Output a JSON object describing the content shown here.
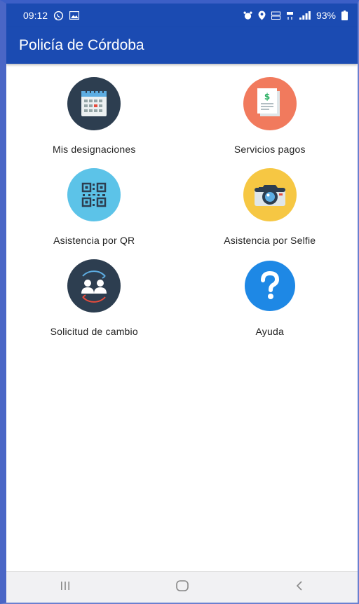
{
  "status": {
    "time": "09:12",
    "battery": "93%"
  },
  "appbar": {
    "title": "Policía de Córdoba"
  },
  "colors": {
    "primary": "#1b4bb2",
    "calendar_bg": "#2d3e50",
    "payments_bg": "#f17a5d",
    "qr_bg": "#5cc3e8",
    "camera_bg": "#f6c743",
    "exchange_bg": "#2d3e50",
    "help_bg": "#1e88e5"
  },
  "menu": [
    {
      "label": "Mis designaciones",
      "icon": "calendar-icon"
    },
    {
      "label": "Servicios pagos",
      "icon": "payment-receipt-icon"
    },
    {
      "label": "Asistencia por QR",
      "icon": "qr-code-icon"
    },
    {
      "label": "Asistencia por Selfie",
      "icon": "camera-icon"
    },
    {
      "label": "Solicitud de cambio",
      "icon": "users-exchange-icon"
    },
    {
      "label": "Ayuda",
      "icon": "help-icon"
    }
  ]
}
